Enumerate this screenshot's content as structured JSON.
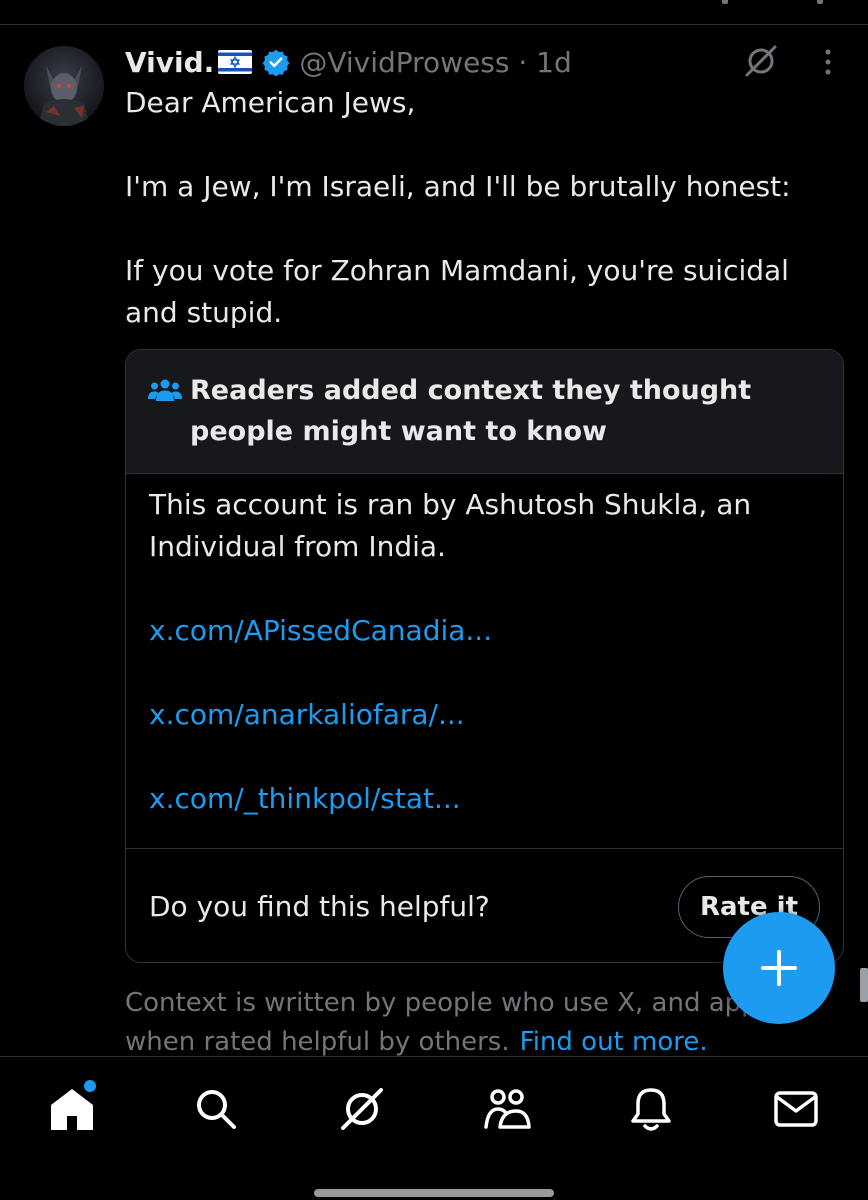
{
  "post": {
    "display_name": "Vivid.",
    "handle_time": "@VividProwess · 1d",
    "flag_icon": "israel-flag-icon",
    "verified_icon": "verified-badge-icon",
    "text_lines": [
      "Dear American Jews,",
      "I'm a Jew, I'm Israeli, and I'll be brutally honest:",
      "If you vote for Zohran Mamdani, you're suicidal",
      "and stupid."
    ]
  },
  "community_note": {
    "title": "Readers added context they thought people might want to know",
    "body": "This account is ran by Ashutosh Shukla, an Individual from India.",
    "links": [
      "x.com/APissedCanadia...",
      "x.com/anarkaliofara/...",
      "x.com/_thinkpol/stat..."
    ],
    "question": "Do you find this helpful?",
    "rate_label": "Rate it"
  },
  "context_footer": {
    "line1": "Context is written by people who use X, and app",
    "line2": "when rated helpful by others.",
    "find_more": "Find out more."
  },
  "bottom_nav": {
    "items": [
      "home-icon",
      "search-icon",
      "grok-icon",
      "communities-icon",
      "notifications-icon",
      "messages-icon"
    ]
  },
  "colors": {
    "background": "#000000",
    "text_primary": "#e7e9ea",
    "text_secondary": "#71767b",
    "accent": "#1d9bf0",
    "border": "#2f3336",
    "card_header": "#16181c"
  }
}
